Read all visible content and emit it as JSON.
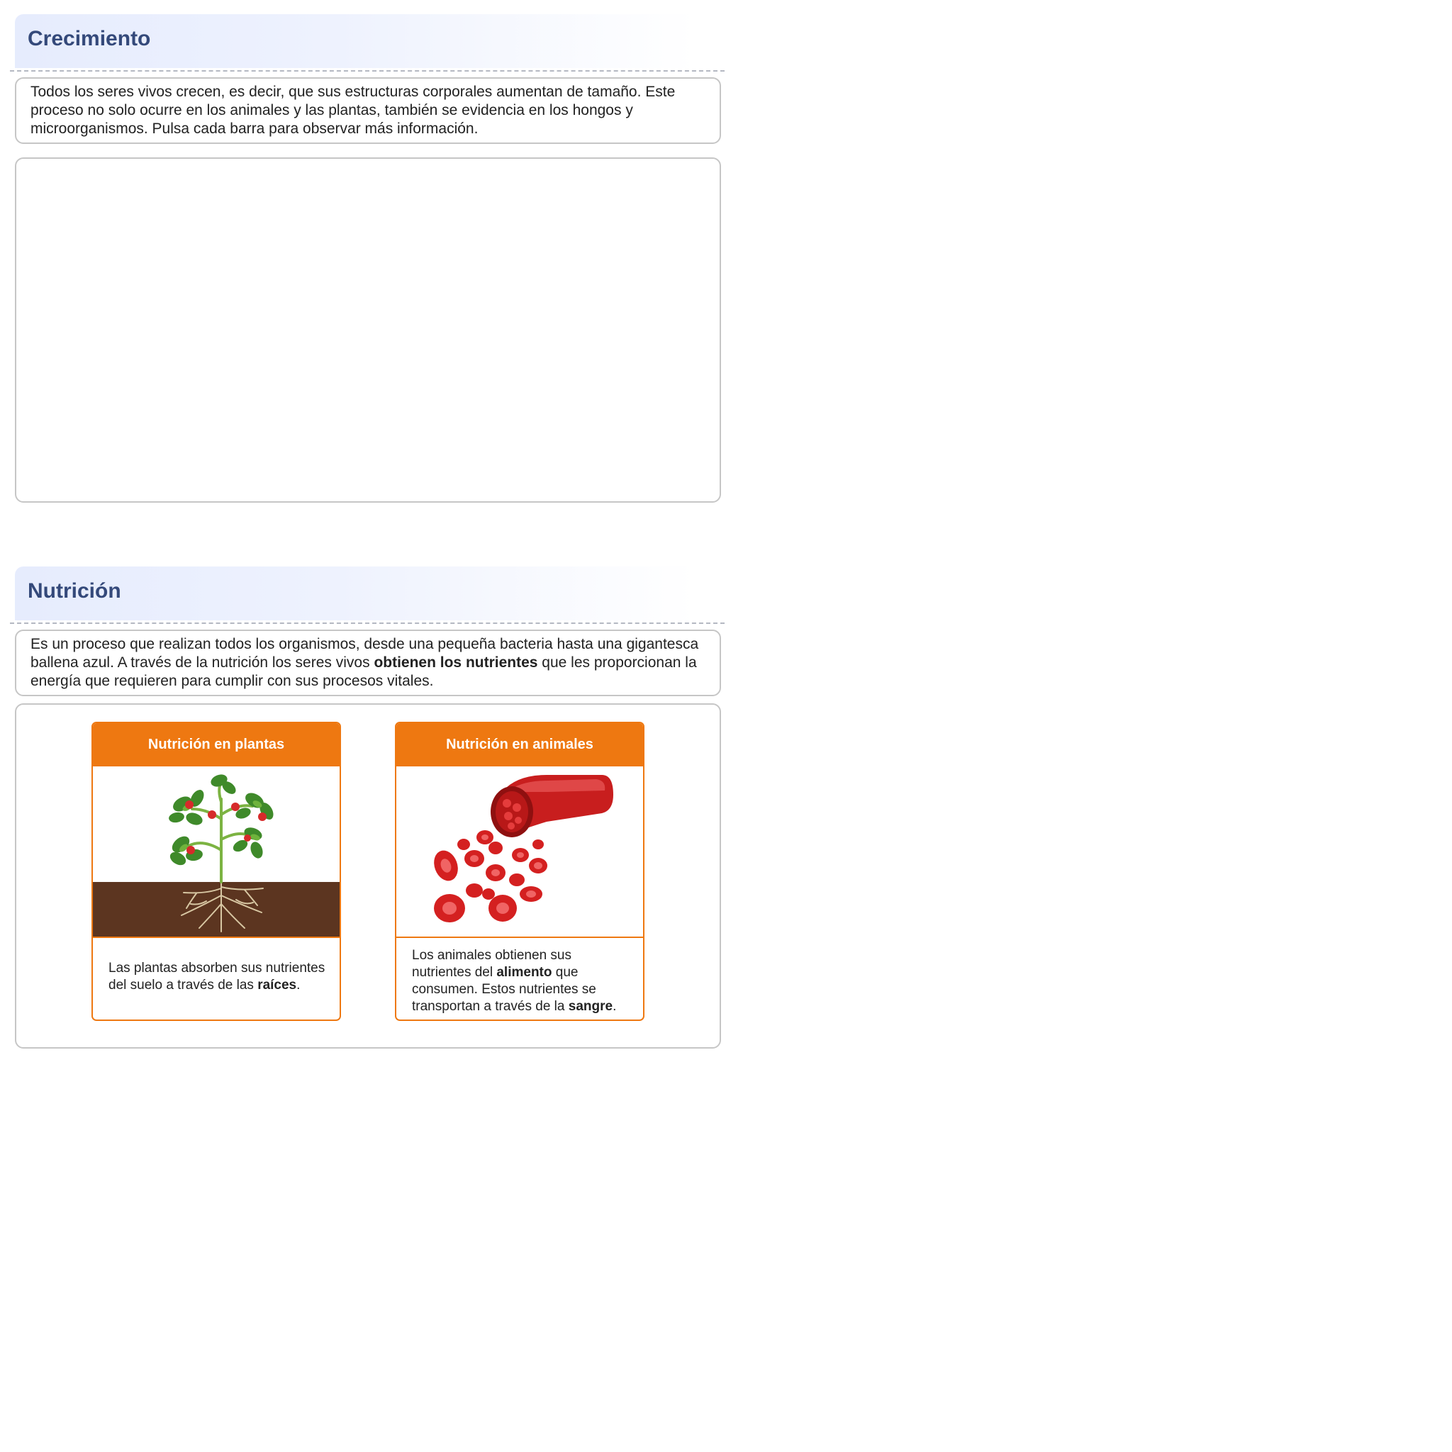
{
  "growth": {
    "title": "Crecimiento",
    "paragraph": "Todos los seres vivos crecen, es decir, que sus estructuras corporales aumentan de tamaño. Este proceso no solo ocurre en los animales y las plantas, también se evidencia en los hongos y microorganismos. Pulsa cada barra para observar más información."
  },
  "nutrition": {
    "title": "Nutrición",
    "paragraph": {
      "part1": "Es un proceso que realizan todos los organismos, desde una pequeña bacteria hasta una gigantesca ballena azul. A través de la nutrición los seres vivos ",
      "bold": "obtienen los nutrientes",
      "part2": " que les proporcionan la energía que requieren para cumplir con sus procesos vitales."
    },
    "cards": [
      {
        "title": "Nutrición en plantas",
        "image_icon": "tomato-plant-with-roots-illustration",
        "text_before": "Las plantas absorben sus nutrientes del suelo a través de las ",
        "text_bold": "raíces",
        "text_after": "."
      },
      {
        "title": "Nutrición en animales",
        "image_icon": "blood-vessel-red-cells-illustration",
        "text_before": "Los animales obtienen sus nutrientes del ",
        "text_bold": "alimento",
        "text_middle": " que consumen. Estos nutrientes se transportan a través de la ",
        "text_bold2": "sangre",
        "text_after": "."
      }
    ]
  },
  "colors": {
    "title": "#34497a",
    "accent_orange": "#ee7811",
    "box_border": "#c6c6c6",
    "header_gradient_start": "#e6ecfd",
    "soil": "#5c3520"
  }
}
